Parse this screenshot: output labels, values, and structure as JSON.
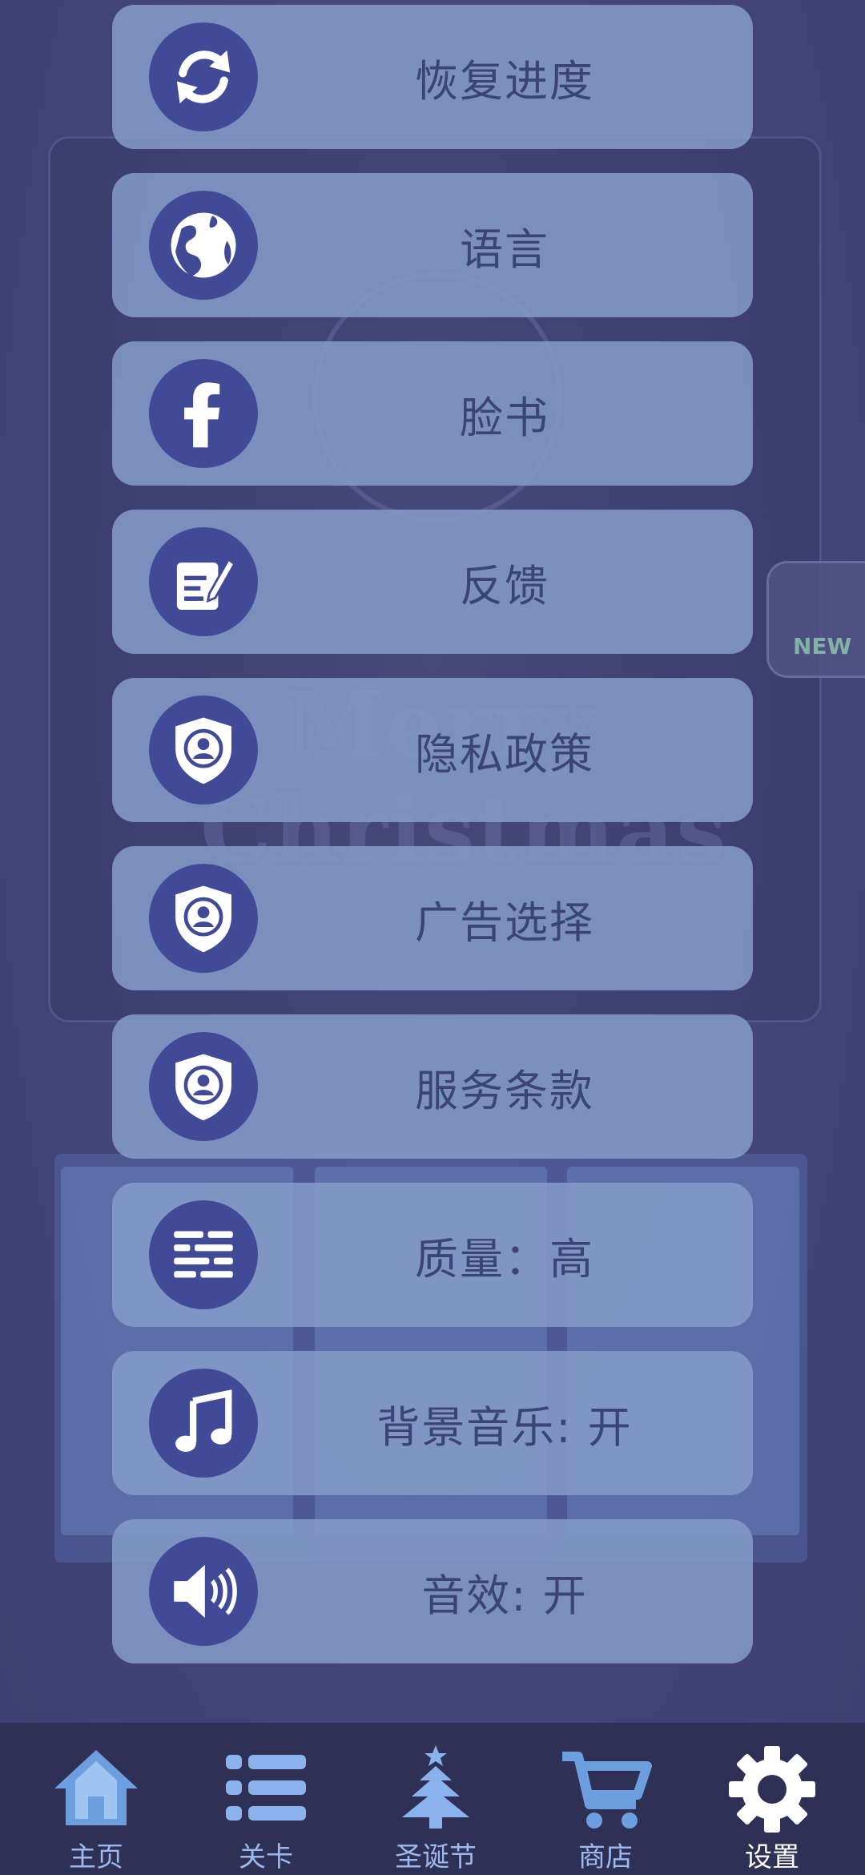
{
  "menu": {
    "items": [
      {
        "label": "恢复进度",
        "icon": "restore-icon"
      },
      {
        "label": "语言",
        "icon": "globe-icon"
      },
      {
        "label": "脸书",
        "icon": "facebook-icon"
      },
      {
        "label": "反馈",
        "icon": "feedback-icon"
      },
      {
        "label": "隐私政策",
        "icon": "shield-user-icon"
      },
      {
        "label": "广告选择",
        "icon": "shield-user-icon"
      },
      {
        "label": "服务条款",
        "icon": "shield-user-icon"
      },
      {
        "label": "质量：高",
        "icon": "sliders-icon"
      },
      {
        "label": "背景音乐: 开",
        "icon": "music-icon"
      },
      {
        "label": "音效: 开",
        "icon": "speaker-icon"
      }
    ]
  },
  "background": {
    "xmas_text": "Merry Christmas",
    "new_badge": "NEW"
  },
  "tabbar": {
    "tabs": [
      {
        "label": "主页",
        "icon": "home-icon"
      },
      {
        "label": "关卡",
        "icon": "list-icon"
      },
      {
        "label": "圣诞节",
        "icon": "christmas-tree-icon"
      },
      {
        "label": "商店",
        "icon": "cart-icon"
      },
      {
        "label": "设置",
        "icon": "gear-icon",
        "active": true
      }
    ]
  },
  "colors": {
    "menu_item_bg": "#859cc9",
    "icon_circle": "#414a96",
    "menu_text": "#3a4476",
    "tabbar_bg": "#2f3055",
    "tab_label": "#9bb9ec",
    "tab_label_active": "#ffffff"
  }
}
